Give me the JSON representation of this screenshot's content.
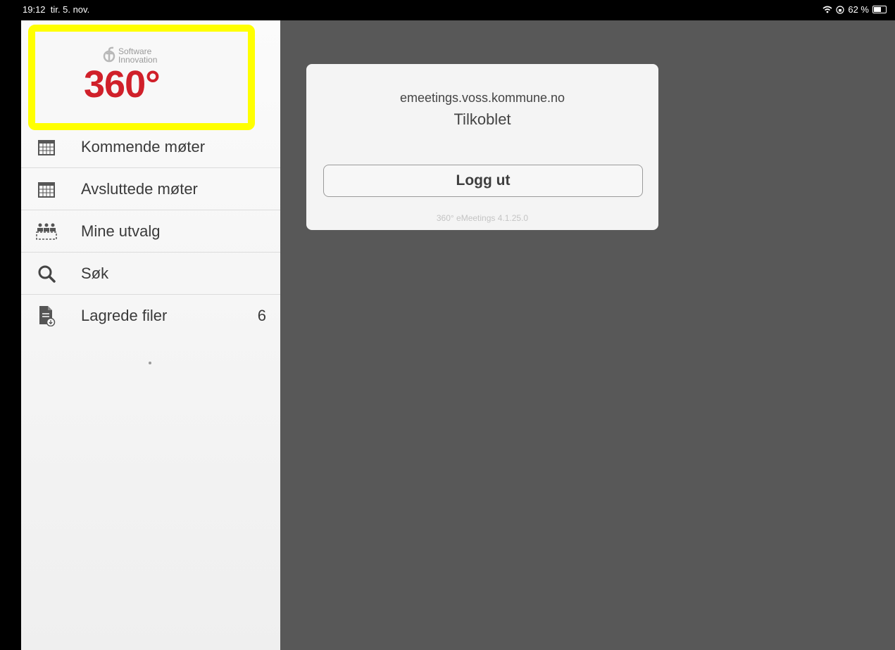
{
  "status_bar": {
    "time": "19:12",
    "date": "tir. 5. nov.",
    "battery": "62 %",
    "battery_level": 0.62
  },
  "logo": {
    "brand_line1": "Software",
    "brand_line2": "Innovation",
    "brand_number": "360°"
  },
  "sidebar": {
    "items": [
      {
        "label": "Kommende møter",
        "icon": "calendar-icon"
      },
      {
        "label": "Avsluttede møter",
        "icon": "calendar-icon"
      },
      {
        "label": "Mine utvalg",
        "icon": "committee-icon"
      },
      {
        "label": "Søk",
        "icon": "search-icon"
      },
      {
        "label": "Lagrede filer",
        "icon": "saved-file-icon",
        "count": "6"
      }
    ]
  },
  "connection": {
    "server": "emeetings.voss.kommune.no",
    "status": "Tilkoblet",
    "logout_label": "Logg ut",
    "version": "360° eMeetings 4.1.25.0"
  },
  "colors": {
    "accent_red": "#d0202a",
    "highlight": "#ffff00",
    "main_bg": "#585858"
  }
}
